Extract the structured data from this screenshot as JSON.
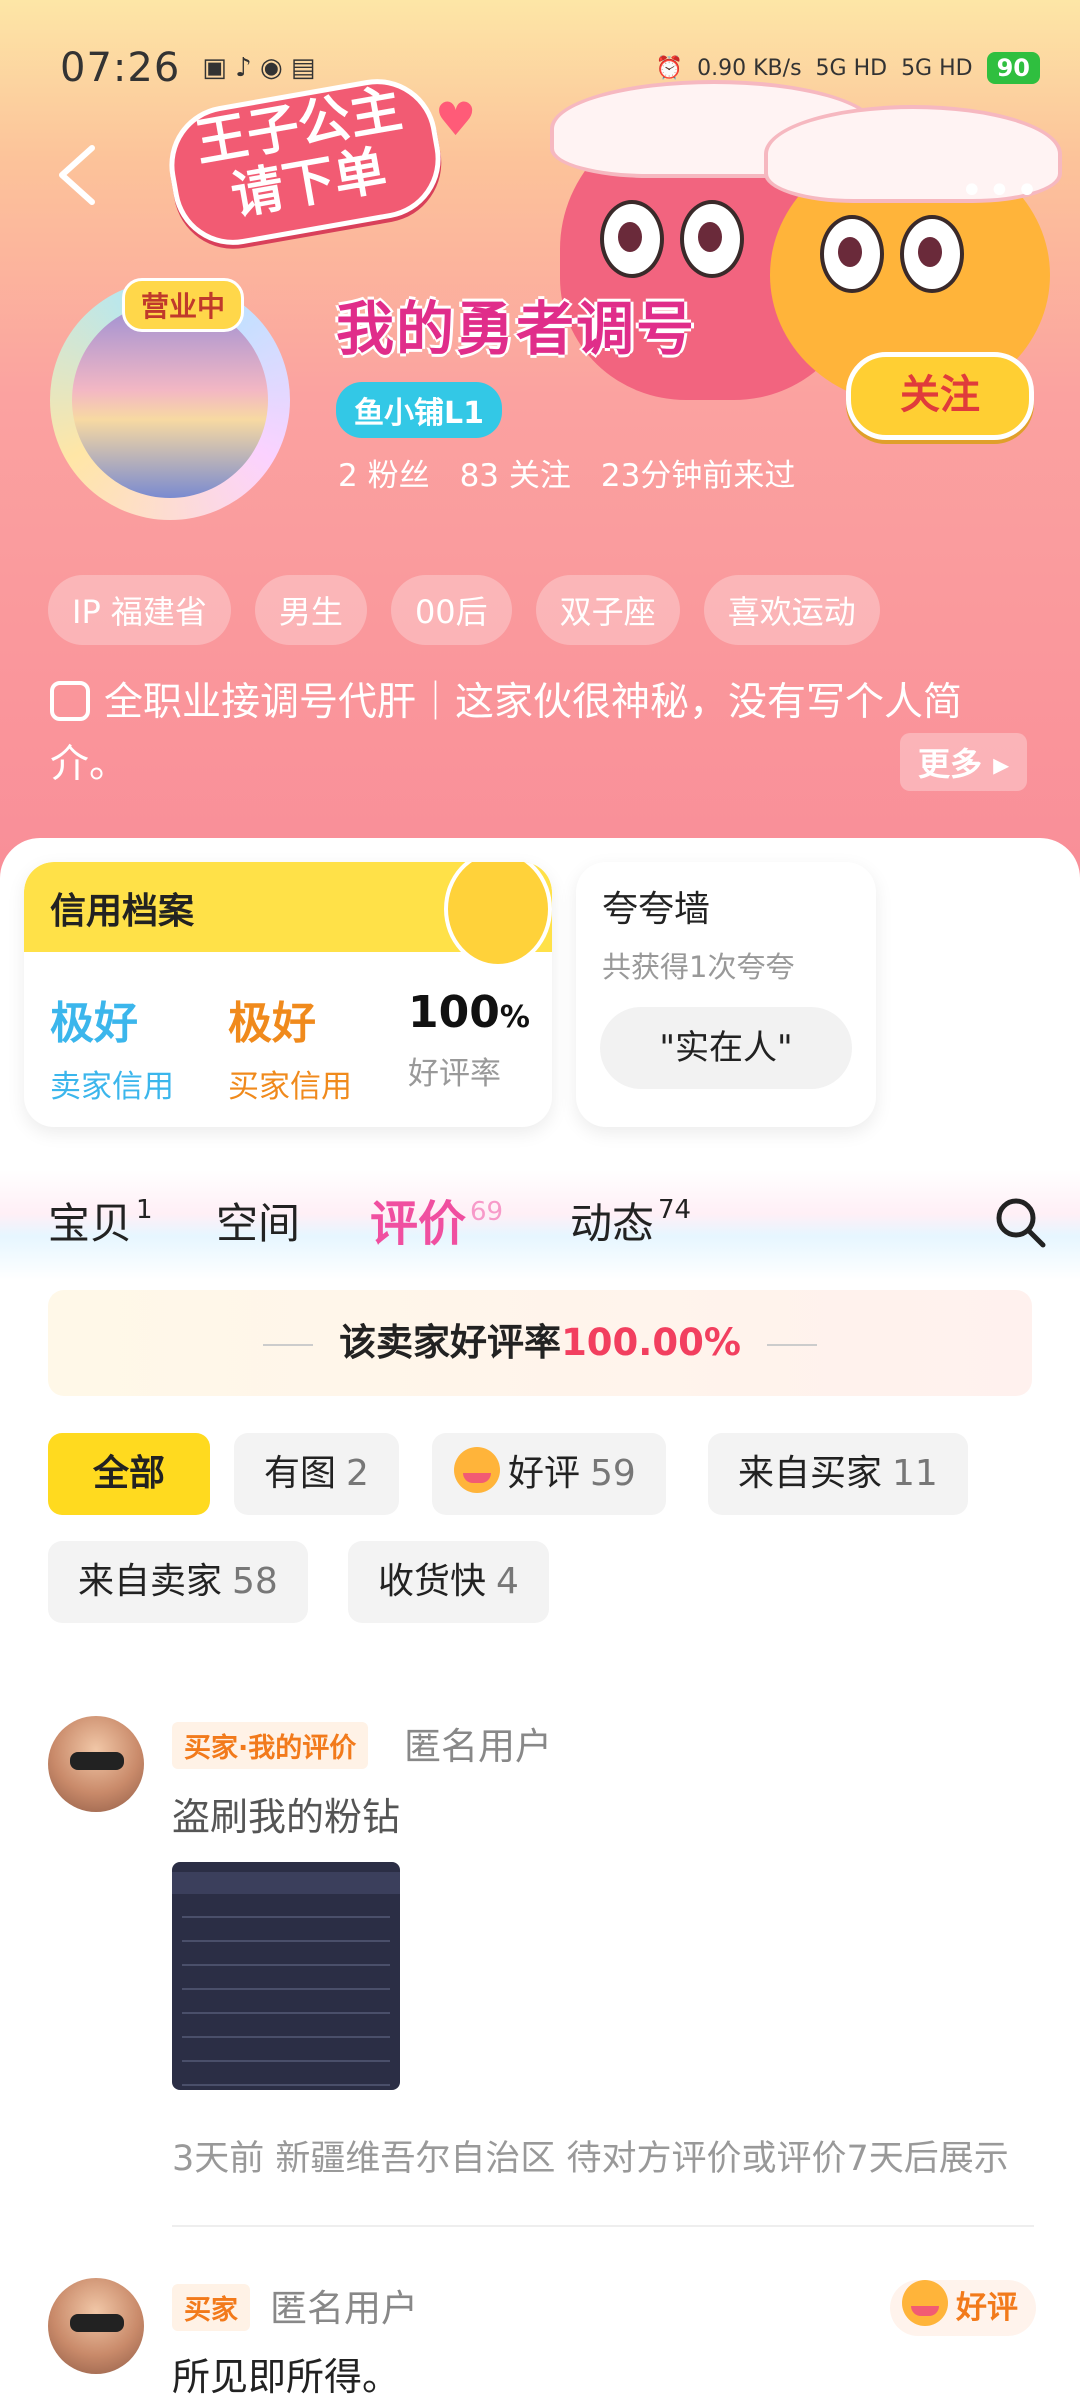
{
  "status_bar": {
    "time": "07:26",
    "net_speed": "0.90 KB/s",
    "signal1": "5G HD",
    "signal2": "5G HD",
    "battery": "90"
  },
  "header": {
    "banner_sticker": [
      "王子公主",
      "请下单"
    ],
    "business_badge": "营业中",
    "shop_name": "我的勇者调号",
    "level": "鱼小铺L1",
    "follow_label": "关注",
    "stats": [
      "2 粉丝",
      "83 关注",
      "23分钟前来过"
    ]
  },
  "tags": [
    "IP 福建省",
    "男生",
    "00后",
    "双子座",
    "喜欢运动"
  ],
  "bio": {
    "text": "全职业接调号代肝｜这家伙很神秘，没有写个人简介。",
    "more_label": "更多"
  },
  "credit": {
    "title": "信用档案",
    "seller_value": "极好",
    "seller_label": "卖家信用",
    "buyer_value": "极好",
    "buyer_label": "买家信用",
    "rate_value": "100",
    "rate_unit": "%",
    "rate_label": "好评率"
  },
  "praise": {
    "title": "夸夸墙",
    "subtitle": "共获得1次夸夸",
    "chip": "\"实在人\""
  },
  "tabs": [
    {
      "label": "宝贝",
      "count": "1"
    },
    {
      "label": "空间",
      "count": ""
    },
    {
      "label": "评价",
      "count": "69"
    },
    {
      "label": "动态",
      "count": "74"
    }
  ],
  "active_tab": "评价",
  "rate_banner": {
    "prefix": "该卖家好评率",
    "value": "100.00%"
  },
  "filters": [
    {
      "label": "全部",
      "count": ""
    },
    {
      "label": "有图",
      "count": "2"
    },
    {
      "label": "好评",
      "count": "59"
    },
    {
      "label": "来自买家",
      "count": "11"
    },
    {
      "label": "来自卖家",
      "count": "58"
    },
    {
      "label": "收货快",
      "count": "4"
    }
  ],
  "reviews": [
    {
      "role": "买家·我的评价",
      "user": "匿名用户",
      "text": "盗刷我的粉钻",
      "meta": "3天前  新疆维吾尔自治区  待对方评价或评价7天后展示"
    },
    {
      "role": "买家",
      "user": "匿名用户",
      "text": "所见即所得。",
      "rating": "好评"
    }
  ]
}
